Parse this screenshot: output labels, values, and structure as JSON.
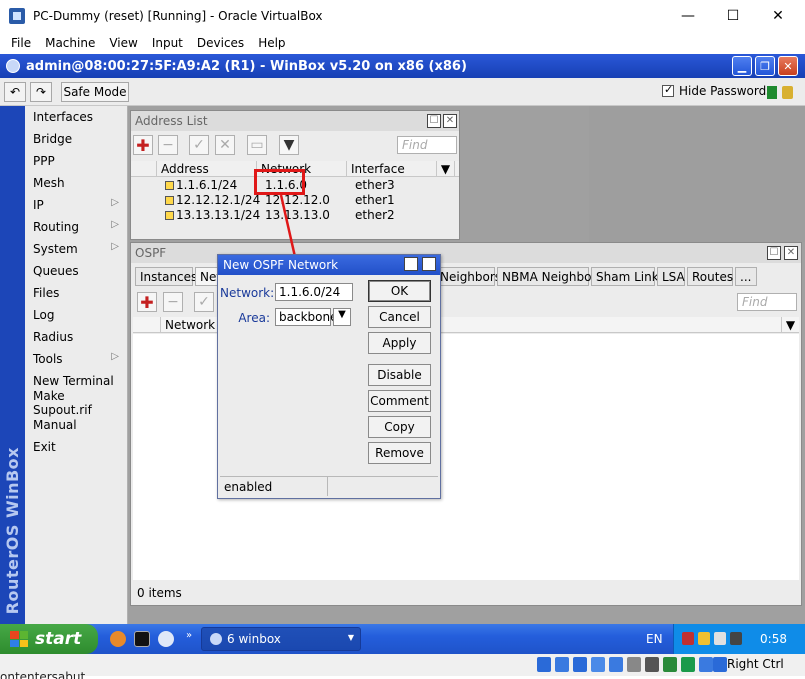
{
  "vbox": {
    "title": "PC-Dummy (reset) [Running] - Oracle VirtualBox",
    "controls": {
      "minimize": "—",
      "maximize": "☐",
      "close": "✕"
    },
    "menu": [
      "File",
      "Machine",
      "View",
      "Input",
      "Devices",
      "Help"
    ]
  },
  "winbox": {
    "title": "admin@08:00:27:5F:A9:A2 (R1) - WinBox v5.20 on x86 (x86)",
    "toolbar": {
      "undo": "↶",
      "redo": "↷",
      "safe_mode": "Safe Mode",
      "hide_passwords": "Hide Passwords",
      "hide_passwords_checked": true
    }
  },
  "sidebar": {
    "brand": "RouterOS WinBox",
    "items": [
      {
        "label": "Interfaces",
        "submenu": false
      },
      {
        "label": "Bridge",
        "submenu": false
      },
      {
        "label": "PPP",
        "submenu": false
      },
      {
        "label": "Mesh",
        "submenu": false
      },
      {
        "label": "IP",
        "submenu": true
      },
      {
        "label": "Routing",
        "submenu": true
      },
      {
        "label": "System",
        "submenu": true
      },
      {
        "label": "Queues",
        "submenu": false
      },
      {
        "label": "Files",
        "submenu": false
      },
      {
        "label": "Log",
        "submenu": false
      },
      {
        "label": "Radius",
        "submenu": false
      },
      {
        "label": "Tools",
        "submenu": true
      },
      {
        "label": "New Terminal",
        "submenu": false
      },
      {
        "label": "Make Supout.rif",
        "submenu": false
      },
      {
        "label": "Manual",
        "submenu": false
      },
      {
        "label": "Exit",
        "submenu": false
      }
    ],
    "submenu_arrow": "▷"
  },
  "address_list": {
    "title": "Address List",
    "find_placeholder": "Find",
    "columns": [
      "Address",
      "Network",
      "Interface"
    ],
    "rows": [
      {
        "address": "1.1.6.1/24",
        "network": "1.1.6.0",
        "interface": "ether3"
      },
      {
        "address": "12.12.12.1/24",
        "network": "12.12.12.0",
        "interface": "ether1"
      },
      {
        "address": "13.13.13.1/24",
        "network": "13.13.13.0",
        "interface": "ether2"
      }
    ]
  },
  "ospf": {
    "title": "OSPF",
    "tabs": [
      "Instances",
      "Netw",
      "Neighbors",
      "NBMA Neighbors",
      "Sham Links",
      "LSA",
      "Routes",
      "..."
    ],
    "find_placeholder": "Find",
    "columns": [
      "Network"
    ],
    "item_count": "0 items"
  },
  "dialog": {
    "title": "New OSPF Network",
    "network_label": "Network:",
    "network_value": "1.1.6.0/24",
    "area_label": "Area:",
    "area_value": "backbone",
    "buttons": [
      "OK",
      "Cancel",
      "Apply",
      "Disable",
      "Comment",
      "Copy",
      "Remove"
    ],
    "status": "enabled"
  },
  "taskbar": {
    "start": "start",
    "task": "6 winbox",
    "language": "EN",
    "clock": "0:58"
  },
  "vbox_status": {
    "host_key": "Right Ctrl"
  },
  "bottom_text": "ontentersabut"
}
